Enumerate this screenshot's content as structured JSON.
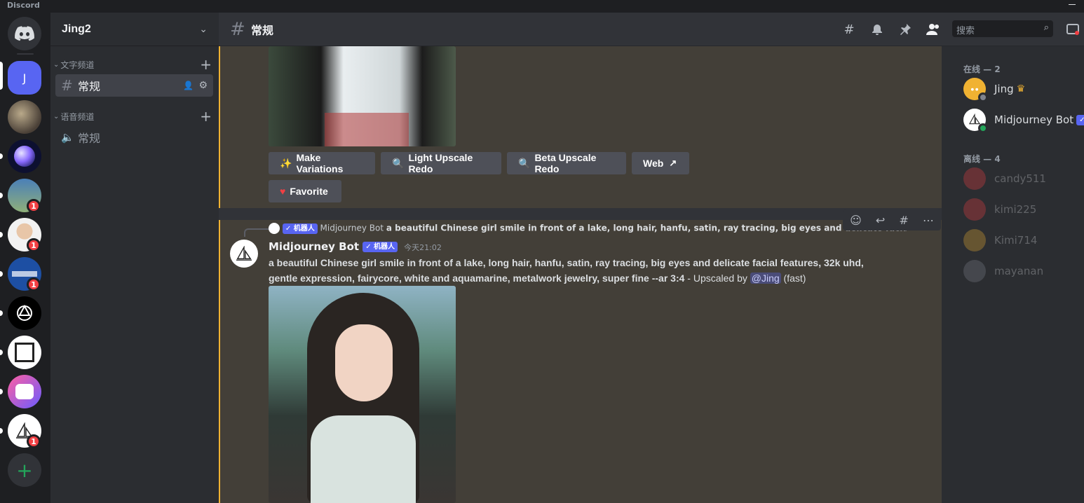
{
  "titlebar": {
    "app_name": "Discord"
  },
  "guild": {
    "name": "Jing2"
  },
  "rail": {
    "home_letter": "J",
    "badge_count": "1"
  },
  "categories": {
    "text": "文字频道",
    "voice": "语音频道"
  },
  "channels": {
    "text_general": "常规",
    "voice_general": "常规"
  },
  "topbar": {
    "channel": "常规",
    "search_placeholder": "搜索"
  },
  "message1": {
    "buttons": {
      "make_variations": "Make Variations",
      "light_upscale": "Light Upscale Redo",
      "beta_upscale": "Beta Upscale Redo",
      "web": "Web",
      "favorite": "Favorite"
    }
  },
  "message2": {
    "reply_tag": "✓ 机器人",
    "reply_author": "Midjourney Bot",
    "reply_text": "a beautiful Chinese girl smile in front of a lake, long hair, hanfu, satin, ray tracing, big eyes and delicate facial feature",
    "author": "Midjourney Bot",
    "bot_tag": "✓ 机器人",
    "timestamp": "今天21:02",
    "prompt_line1": "a beautiful Chinese girl smile in front of a lake, long hair, hanfu, satin, ray tracing, big eyes and delicate facial features, 32k uhd,",
    "prompt_line2": "gentle expression, fairycore, white and aquamarine, metalwork jewelry, super fine --ar 3:4",
    "suffix_pre": " - Upscaled by ",
    "mention": "@Jing",
    "suffix_post": " (fast)"
  },
  "members": {
    "online_header": "在线 — 2",
    "offline_header": "离线 — 4",
    "online": [
      "Jing",
      "Midjourney Bot"
    ],
    "offline": [
      "candy511",
      "kimi225",
      "Kimi714",
      "mayanan"
    ],
    "owner_crown": "♛",
    "bot_tag": "✓"
  },
  "colors": {
    "accent": "#5865f2",
    "highlight_border": "#f0b232",
    "badge_red": "#f23f43",
    "online_green": "#23a55a"
  }
}
